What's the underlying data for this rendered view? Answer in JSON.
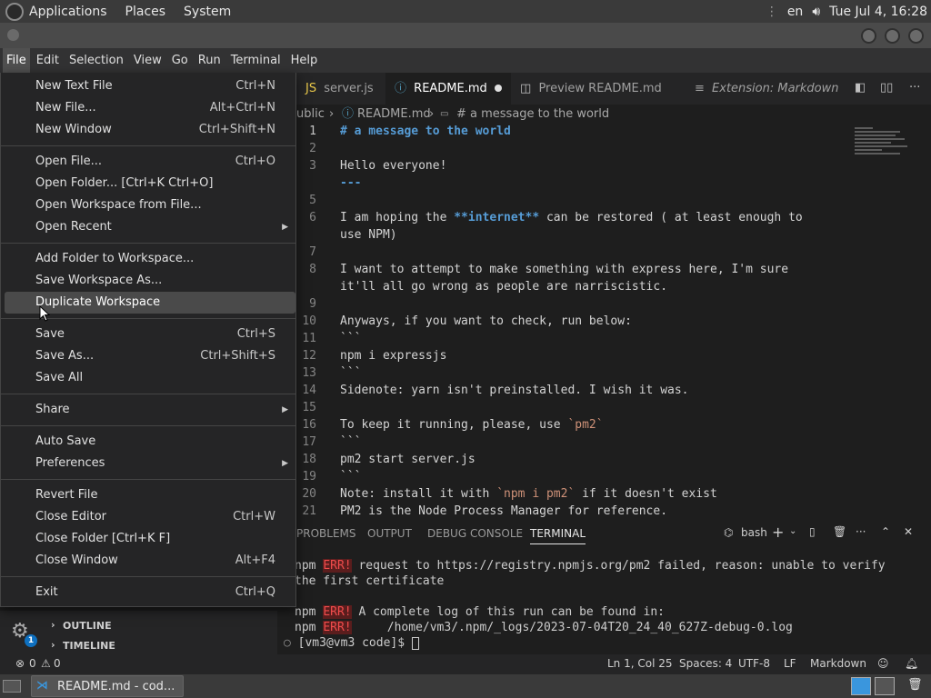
{
  "system": {
    "menus": [
      "Applications",
      "Places",
      "System"
    ],
    "lang": "en",
    "clock": "Tue Jul  4, 16:28"
  },
  "menubar": [
    "File",
    "Edit",
    "Selection",
    "View",
    "Go",
    "Run",
    "Terminal",
    "Help"
  ],
  "tabs": [
    {
      "label": "server.js"
    },
    {
      "label": "README.md",
      "active": true,
      "modified": true
    },
    {
      "label": "Preview README.md"
    },
    {
      "label": "Extension: Markdown Previ"
    }
  ],
  "breadcrumb": {
    "folder": "ublic",
    "file": "README.md",
    "heading": "# a message to the world"
  },
  "editor": {
    "lines": [
      {
        "n": "1",
        "t": "# a message to the world",
        "cls": "md-h"
      },
      {
        "n": "2",
        "t": ""
      },
      {
        "n": "3",
        "t": "Hello everyone!"
      },
      {
        "n": "",
        "t": "---",
        "cls": "md-h"
      },
      {
        "n": "5",
        "t": ""
      },
      {
        "n": "6",
        "t": "I am hoping the **internet** can be restored ( at least enough to"
      },
      {
        "n": "",
        "t": "use NPM)"
      },
      {
        "n": "7",
        "t": ""
      },
      {
        "n": "8",
        "t": "I want to attempt to make something with express here, I'm sure"
      },
      {
        "n": "",
        "t": "it'll all go wrong as people are narriscistic."
      },
      {
        "n": "9",
        "t": ""
      },
      {
        "n": "10",
        "t": "Anyways, if you want to check, run below:"
      },
      {
        "n": "11",
        "t": "```"
      },
      {
        "n": "12",
        "t": "npm i expressjs"
      },
      {
        "n": "13",
        "t": "```"
      },
      {
        "n": "14",
        "t": "Sidenote: yarn isn't preinstalled. I wish it was."
      },
      {
        "n": "15",
        "t": ""
      },
      {
        "n": "16",
        "t": "To keep it running, please, use `pm2`"
      },
      {
        "n": "17",
        "t": "```"
      },
      {
        "n": "18",
        "t": "pm2 start server.js"
      },
      {
        "n": "19",
        "t": "```"
      },
      {
        "n": "20",
        "t": "Note: install it with `npm i pm2` if it doesn't exist"
      },
      {
        "n": "21",
        "t": "PM2 is the Node Process Manager for reference."
      }
    ]
  },
  "panel": {
    "tabs": [
      "PROBLEMS",
      "OUTPUT",
      "DEBUG CONSOLE",
      "TERMINAL"
    ],
    "shell": "bash",
    "terminal": {
      "l1a": "npm ",
      "l1err": "ERR!",
      "l1b": " request to https://registry.npmjs.org/pm2 failed, reason: unable to verify",
      "l2": "the first certificate",
      "l3a": "npm ",
      "l3err": "ERR!",
      "l3b": " A complete log of this run can be found in:",
      "l4a": "npm ",
      "l4err": "ERR!",
      "l4b": "     /home/vm3/.npm/_logs/2023-07-04T20_24_40_627Z-debug-0.log",
      "prompt": "[vm3@vm3 code]$ "
    }
  },
  "sidebar": {
    "outline": "OUTLINE",
    "timeline": "TIMELINE",
    "badge": "1"
  },
  "status": {
    "errors": "0",
    "warnings": "0",
    "position": "Ln 1, Col 25",
    "spaces": "Spaces: 4",
    "encoding": "UTF-8",
    "eol": "LF",
    "lang": "Markdown"
  },
  "taskbar": {
    "window": "README.md - cod..."
  },
  "file_menu": {
    "new_text_file": {
      "label": "New Text File",
      "shortcut": "Ctrl+N"
    },
    "new_file": {
      "label": "New File...",
      "shortcut": "Alt+Ctrl+N"
    },
    "new_window": {
      "label": "New Window",
      "shortcut": "Ctrl+Shift+N"
    },
    "open_file": {
      "label": "Open File...",
      "shortcut": "Ctrl+O"
    },
    "open_folder": {
      "label": "Open Folder... [Ctrl+K Ctrl+O]"
    },
    "open_workspace": {
      "label": "Open Workspace from File..."
    },
    "open_recent": {
      "label": "Open Recent"
    },
    "add_folder": {
      "label": "Add Folder to Workspace..."
    },
    "save_workspace_as": {
      "label": "Save Workspace As..."
    },
    "duplicate_workspace": {
      "label": "Duplicate Workspace"
    },
    "save": {
      "label": "Save",
      "shortcut": "Ctrl+S"
    },
    "save_as": {
      "label": "Save As...",
      "shortcut": "Ctrl+Shift+S"
    },
    "save_all": {
      "label": "Save All"
    },
    "share": {
      "label": "Share"
    },
    "auto_save": {
      "label": "Auto Save"
    },
    "preferences": {
      "label": "Preferences"
    },
    "revert_file": {
      "label": "Revert File"
    },
    "close_editor": {
      "label": "Close Editor",
      "shortcut": "Ctrl+W"
    },
    "close_folder": {
      "label": "Close Folder [Ctrl+K F]"
    },
    "close_window": {
      "label": "Close Window",
      "shortcut": "Alt+F4"
    },
    "exit": {
      "label": "Exit",
      "shortcut": "Ctrl+Q"
    }
  }
}
